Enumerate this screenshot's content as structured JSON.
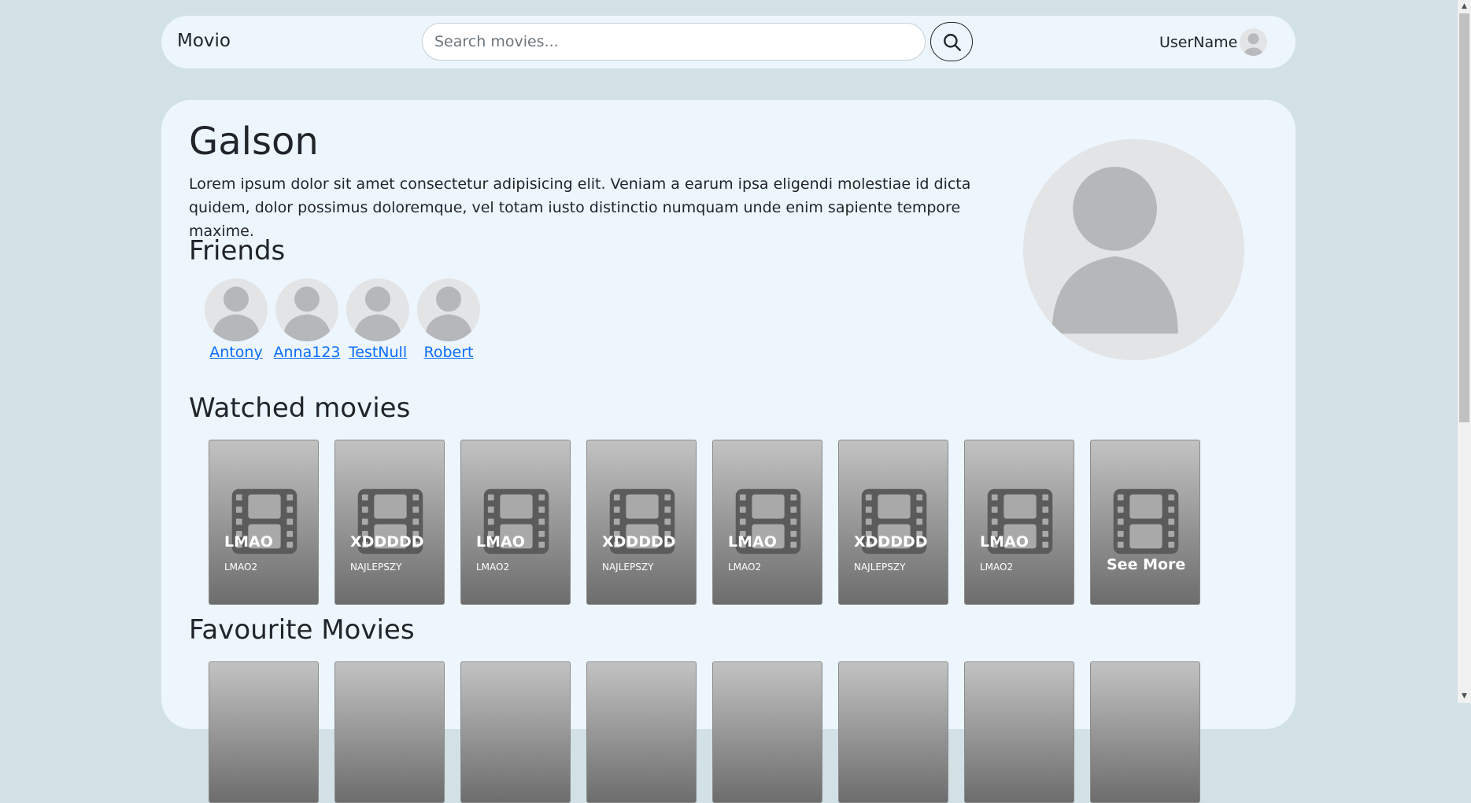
{
  "navbar": {
    "brand": "Movio",
    "search_placeholder": "Search movies...",
    "search_icon": "search-icon",
    "username": "UserName",
    "avatar_icon": "user-avatar"
  },
  "profile": {
    "name": "Galson",
    "bio": "Lorem ipsum dolor sit amet consectetur adipisicing elit. Veniam a earum ipsa eligendi molestiae id dicta quidem, dolor possimus doloremque, vel totam iusto distinctio numquam unde enim sapiente tempore maxime."
  },
  "friends": {
    "title": "Friends",
    "items": [
      {
        "name": "Antony"
      },
      {
        "name": "Anna123"
      },
      {
        "name": "TestNull"
      },
      {
        "name": "Robert"
      }
    ]
  },
  "watched": {
    "title": "Watched movies",
    "items": [
      {
        "title": "LMAO",
        "subtitle": "LMAO2"
      },
      {
        "title": "XDDDDD",
        "subtitle": "NAJLEPSZY"
      },
      {
        "title": "LMAO",
        "subtitle": "LMAO2"
      },
      {
        "title": "XDDDDD",
        "subtitle": "NAJLEPSZY"
      },
      {
        "title": "LMAO",
        "subtitle": "LMAO2"
      },
      {
        "title": "XDDDDD",
        "subtitle": "NAJLEPSZY"
      },
      {
        "title": "LMAO",
        "subtitle": "LMAO2"
      }
    ],
    "see_more": "See More"
  },
  "favourites": {
    "title": "Favourite Movies"
  },
  "colors": {
    "page_background": "#d2e1e6",
    "panel_background": "#edf6fd",
    "link": "#0d6efd",
    "card_top": "#c2c2c2",
    "card_bottom": "#6d6d6d"
  }
}
